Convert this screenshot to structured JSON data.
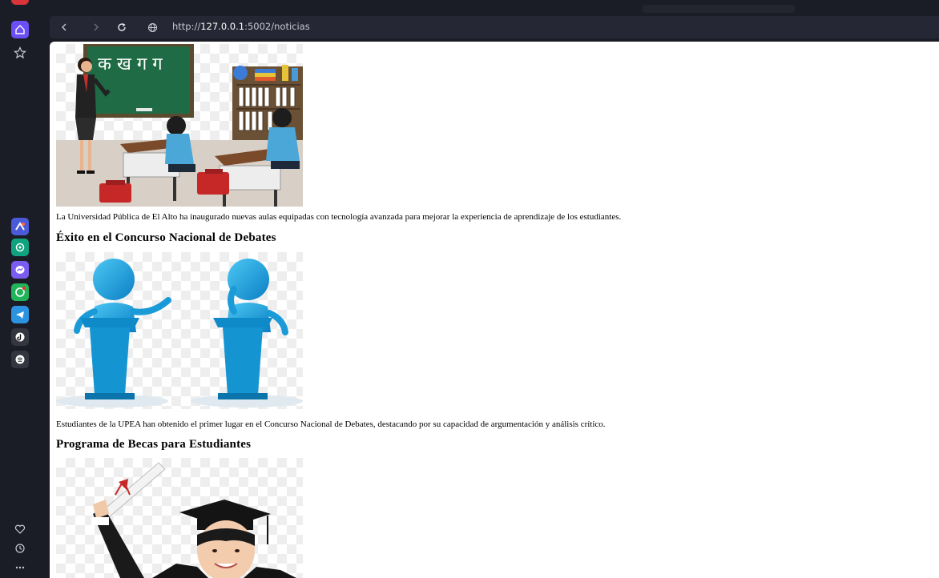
{
  "browser": {
    "url_prefix": "http://",
    "url_host": "127.0.0.1",
    "url_rest": ":5002/noticias"
  },
  "sidebar": {
    "top_items": [
      "home-icon",
      "star-icon"
    ],
    "apps": [
      "aria-icon",
      "chatgpt-icon",
      "messenger-icon",
      "whatsapp-icon",
      "telegram-icon",
      "tiktok-icon",
      "spotify-icon"
    ],
    "bottom_items": [
      "heart-icon",
      "history-icon",
      "more-icon"
    ],
    "accent": "#6b4ff5"
  },
  "news": [
    {
      "image": "classroom-illustration",
      "text": "La Universidad Pública de El Alto ha inaugurado nuevas aulas equipadas con tecnología avanzada para mejorar la experiencia de aprendizaje de los estudiantes."
    },
    {
      "title": "Éxito en el Concurso Nacional de Debates",
      "image": "debate-illustration",
      "text": "Estudiantes de la UPEA han obtenido el primer lugar en el Concurso Nacional de Debates, destacando por su capacidad de argumentación y análisis crítico."
    },
    {
      "title": "Programa de Becas para Estudiantes",
      "image": "graduate-photo"
    }
  ],
  "handwriting": "क ख ग ग"
}
